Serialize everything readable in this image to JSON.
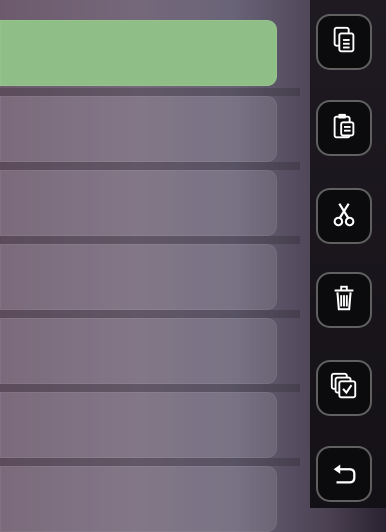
{
  "list": {
    "items": [
      {
        "label": ""
      },
      {
        "label": ""
      },
      {
        "label": ""
      },
      {
        "label": ""
      },
      {
        "label": ""
      },
      {
        "label": ""
      },
      {
        "label": ""
      }
    ]
  },
  "toolbar": {
    "buttons": [
      {
        "icon": "copy-icon"
      },
      {
        "icon": "paste-icon"
      },
      {
        "icon": "cut-icon"
      },
      {
        "icon": "delete-icon"
      },
      {
        "icon": "select-all-icon"
      },
      {
        "icon": "back-icon"
      }
    ]
  },
  "colors": {
    "selected_row": "#8fbf86",
    "rail": "#141116"
  }
}
